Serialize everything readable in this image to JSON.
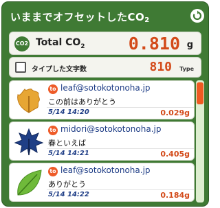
{
  "header": {
    "title": "いままでオフセットしたCO",
    "title_sub": "2",
    "refresh_icon": "refresh-icon"
  },
  "total": {
    "badge": "CO2",
    "label": "Total CO",
    "label_sub": "2",
    "value": "0.810",
    "unit": "g"
  },
  "typed": {
    "label": "タイプした文字数",
    "value": "810",
    "unit": "Type"
  },
  "items": [
    {
      "icon": "orange-leaf-icon",
      "to": "to",
      "address": "leaf@sotokotonoha.jp",
      "message": "この前はありがとう",
      "date": "5/14 14:20",
      "co2": "0.029g"
    },
    {
      "icon": "blue-leaf-icon",
      "to": "to",
      "address": "midori@sotokotonoha.jp",
      "message": "春といえば",
      "date": "5/14 14:21",
      "co2": "0.405g"
    },
    {
      "icon": "green-leaf-icon",
      "to": "to",
      "address": "leaf@sotokotonoha.jp",
      "message": "ありがとう",
      "date": "5/14 14:22",
      "co2": "0.184g"
    }
  ],
  "colors": {
    "accent": "#d34a19",
    "brand": "#3f7a34",
    "link": "#1e3d86"
  }
}
